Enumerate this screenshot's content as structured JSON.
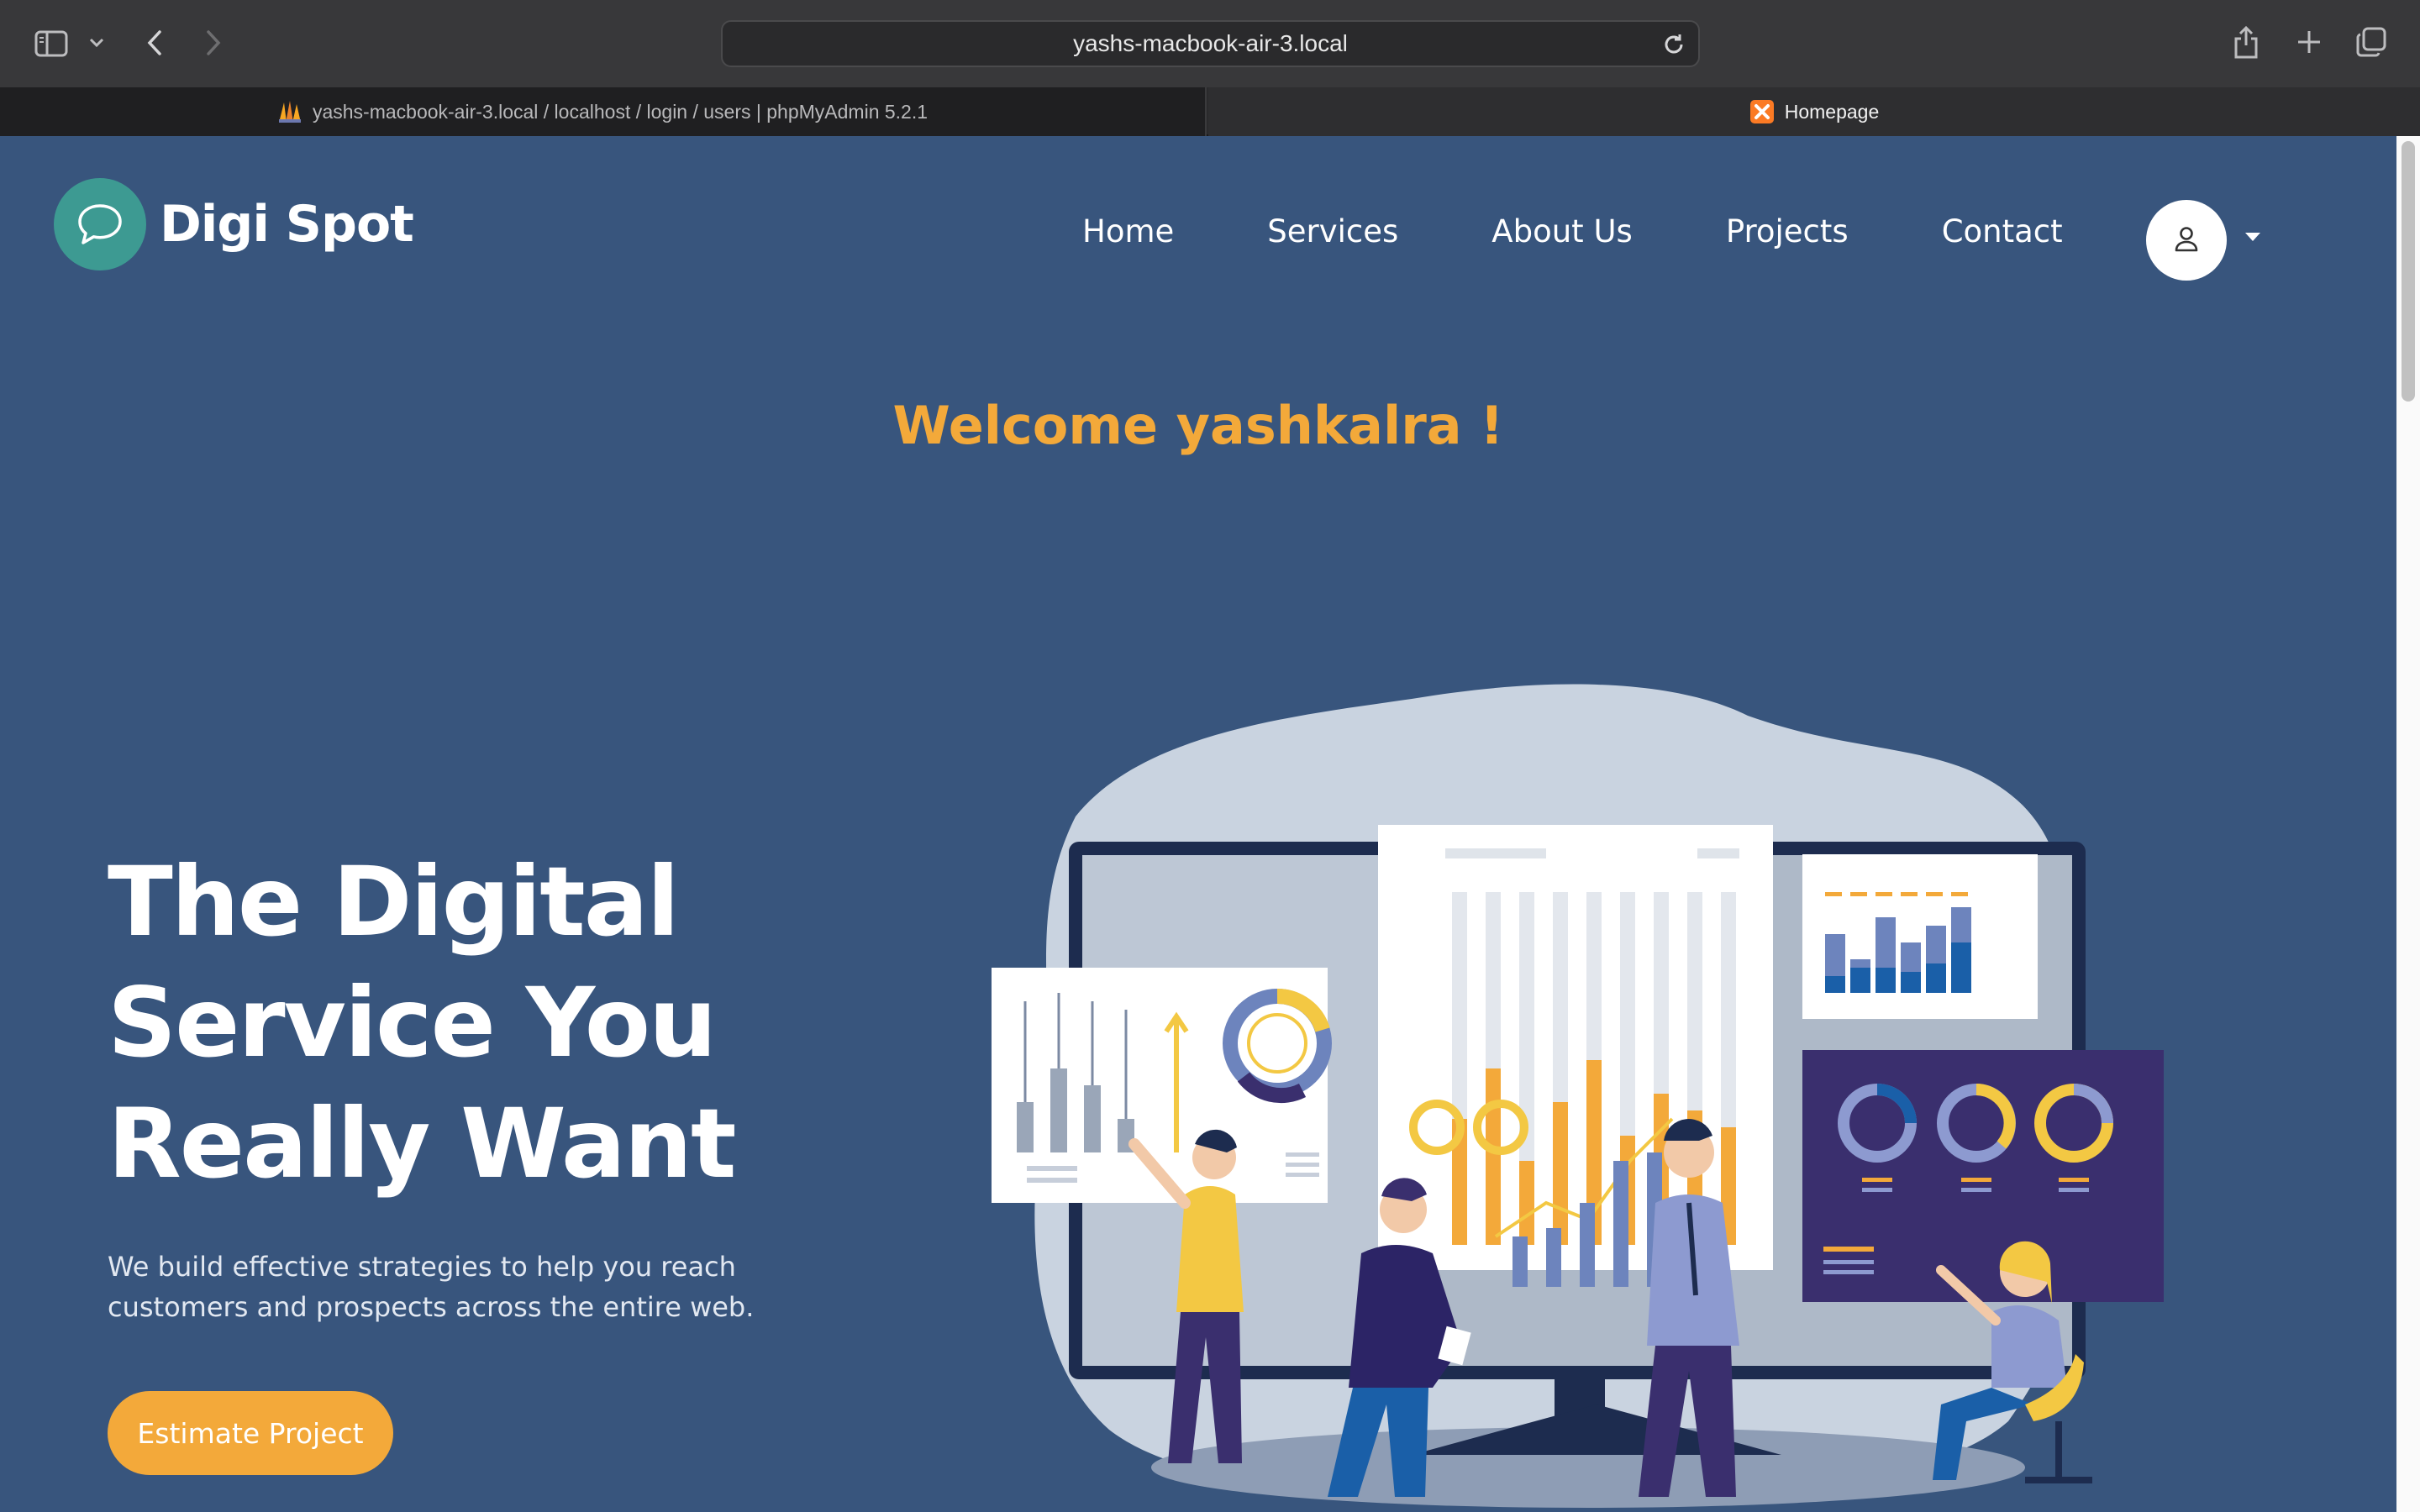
{
  "browser": {
    "url": "yashs-macbook-air-3.local",
    "tabs": [
      {
        "title": "yashs-macbook-air-3.local / localhost / login / users | phpMyAdmin 5.2.1",
        "active": false
      },
      {
        "title": "Homepage",
        "active": true
      }
    ]
  },
  "header": {
    "logo_text": "Digi Spot",
    "nav": [
      "Home",
      "Services",
      "About Us",
      "Projects",
      "Contact"
    ]
  },
  "welcome": "Welcome yashkalra !",
  "hero": {
    "title_lines": [
      "The Digital",
      "Service You",
      "Really Want"
    ],
    "subtitle_lines": [
      "We build effective strategies to help you reach",
      "customers and prospects across the entire web."
    ],
    "cta_label": "Estimate Project"
  },
  "colors": {
    "page_bg": "#38557d",
    "accent": "#f3a93a",
    "logo_badge": "#3d9a92"
  },
  "icons": [
    "sidebar-toggle-icon",
    "chevron-down-icon",
    "back-icon",
    "forward-icon",
    "reload-icon",
    "share-icon",
    "plus-icon",
    "tabs-overview-icon",
    "phpmyadmin-favicon",
    "xampp-favicon",
    "chat-bubble-icon",
    "user-icon",
    "caret-down-icon"
  ]
}
